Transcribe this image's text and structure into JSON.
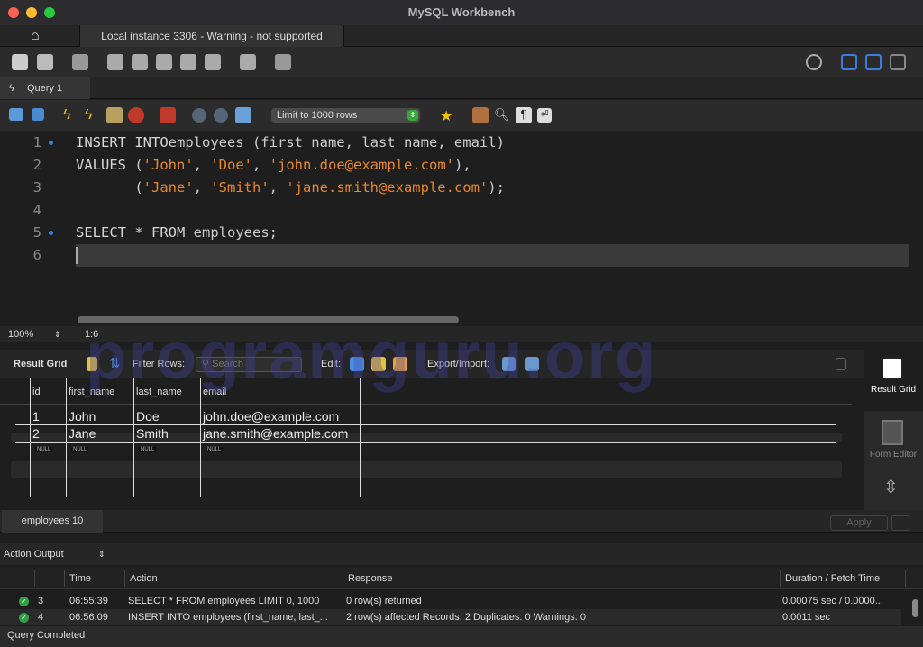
{
  "window": {
    "title": "MySQL Workbench"
  },
  "connection_tab": {
    "label": "Local instance 3306 - Warning - not supported"
  },
  "query_tab": {
    "label": "Query 1"
  },
  "editor_toolbar": {
    "limit_select": "Limit to 1000 rows"
  },
  "editor": {
    "lines": [
      {
        "n": "1",
        "parts": [
          [
            "kw",
            "INSERT INTO"
          ],
          [
            "",
            "employees (first_name, last_name, email)"
          ]
        ],
        "bp": true
      },
      {
        "n": "2",
        "parts": [
          [
            "kw",
            "VALUES"
          ],
          [
            "",
            " ("
          ],
          [
            "str",
            "'John'"
          ],
          [
            "",
            ", "
          ],
          [
            "str",
            "'Doe'"
          ],
          [
            "",
            ", "
          ],
          [
            "str",
            "'john.doe@example.com'"
          ],
          [
            "",
            "),"
          ]
        ]
      },
      {
        "n": "3",
        "parts": [
          [
            "",
            "       ("
          ],
          [
            "str",
            "'Jane'"
          ],
          [
            "",
            ", "
          ],
          [
            "str",
            "'Smith'"
          ],
          [
            "",
            ", "
          ],
          [
            "str",
            "'jane.smith@example.com'"
          ],
          [
            "",
            ");"
          ]
        ]
      },
      {
        "n": "4",
        "parts": []
      },
      {
        "n": "5",
        "parts": [
          [
            "kw",
            "SELECT"
          ],
          [
            "",
            " * "
          ],
          [
            "kw",
            "FROM"
          ],
          [
            "",
            " employees;"
          ]
        ],
        "bp": true
      },
      {
        "n": "6",
        "parts": []
      }
    ]
  },
  "editor_status": {
    "zoom": "100%",
    "cursor": "1:6"
  },
  "result_toolbar": {
    "result_grid": "Result Grid",
    "filter_rows": "Filter Rows:",
    "search_placeholder": "Search",
    "edit": "Edit:",
    "export_import": "Export/Import:"
  },
  "grid": {
    "columns": [
      "id",
      "first_name",
      "last_name",
      "email"
    ],
    "rows": [
      [
        "1",
        "John",
        "Doe",
        "john.doe@example.com"
      ],
      [
        "2",
        "Jane",
        "Smith",
        "jane.smith@example.com"
      ]
    ],
    "null_label": "NULL"
  },
  "side_panel": {
    "result_grid": "Result Grid",
    "form_editor": "Form Editor"
  },
  "result_tab": {
    "label": "employees 10",
    "apply": "Apply"
  },
  "action_output": {
    "selector": "Action Output",
    "columns": [
      "Time",
      "Action",
      "Response",
      "Duration / Fetch Time"
    ],
    "rows": [
      [
        "3",
        "06:55:39",
        "SELECT * FROM employees LIMIT 0, 1000",
        "0 row(s) returned",
        "0.00075 sec / 0.0000..."
      ],
      [
        "4",
        "06:56:09",
        "INSERT INTO employees (first_name, last_...",
        "2 row(s) affected Records: 2  Duplicates: 0  Warnings: 0",
        "0.0011 sec"
      ]
    ]
  },
  "status_bar": {
    "text": "Query Completed"
  },
  "watermark": "programguru.org"
}
